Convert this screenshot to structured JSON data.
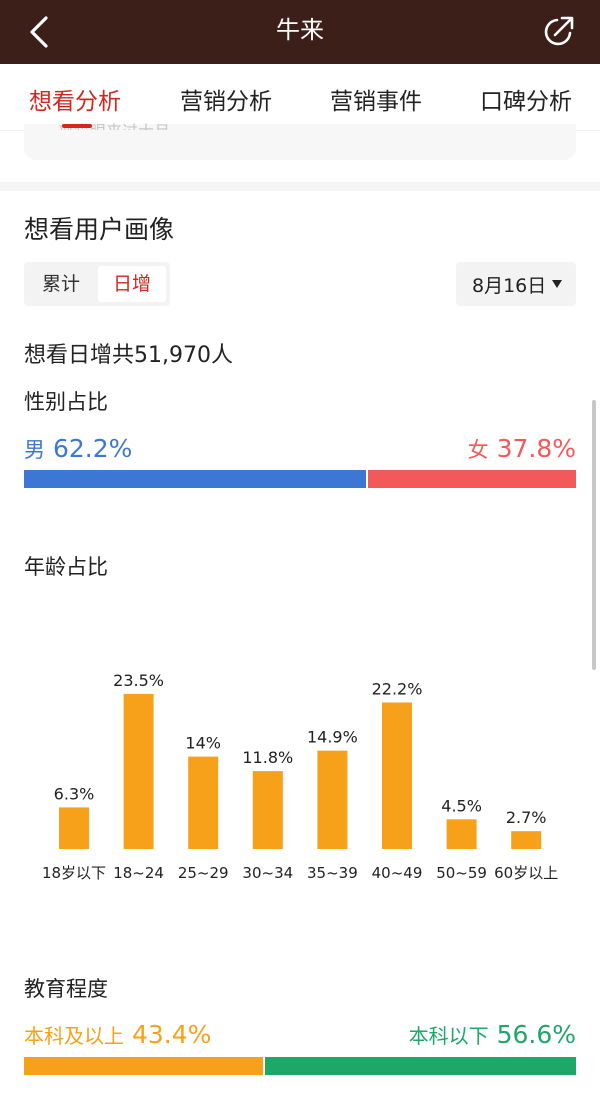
{
  "header": {
    "title": "牛来",
    "back_icon": "chevron-left-icon",
    "share_icon": "share-icon"
  },
  "tabs": [
    {
      "label": "想看分析",
      "active": true
    },
    {
      "label": "营销分析",
      "active": false
    },
    {
      "label": "营销事件",
      "active": false
    },
    {
      "label": "口碑分析",
      "active": false
    }
  ],
  "prev_card": {
    "text": "…部猫眼来过大月…"
  },
  "portrait": {
    "title": "想看用户画像",
    "segments": {
      "cumulative": "累计",
      "daily": "日增",
      "selected": "日增"
    },
    "date": "8月16日",
    "total_prefix": "想看日增共",
    "total_value": "51,970人"
  },
  "gender": {
    "title": "性别占比",
    "male_label": "男",
    "male_value": "62.2%",
    "male_ratio": 0.622,
    "female_label": "女",
    "female_value": "37.8%",
    "male_color": "#3d77d5",
    "female_color": "#f25a5a"
  },
  "age": {
    "title": "年龄占比",
    "color": "#f7a11b"
  },
  "chart_data": {
    "type": "bar",
    "title": "年龄占比",
    "categories": [
      "18岁以下",
      "18~24",
      "25~29",
      "30~34",
      "35~39",
      "40~49",
      "50~59",
      "60岁以上"
    ],
    "values": [
      6.3,
      23.5,
      14,
      11.8,
      14.9,
      22.2,
      4.5,
      2.7
    ],
    "value_labels": [
      "6.3%",
      "23.5%",
      "14%",
      "11.8%",
      "14.9%",
      "22.2%",
      "4.5%",
      "2.7%"
    ],
    "ylim": [
      0,
      25
    ],
    "grid": false,
    "xlabel": "",
    "ylabel": ""
  },
  "education": {
    "title": "教育程度",
    "above_label": "本科及以上",
    "above_value": "43.4%",
    "above_ratio": 0.434,
    "below_label": "本科以下",
    "below_value": "56.6%",
    "above_color": "#f5a11a",
    "below_color": "#1fa76a"
  }
}
